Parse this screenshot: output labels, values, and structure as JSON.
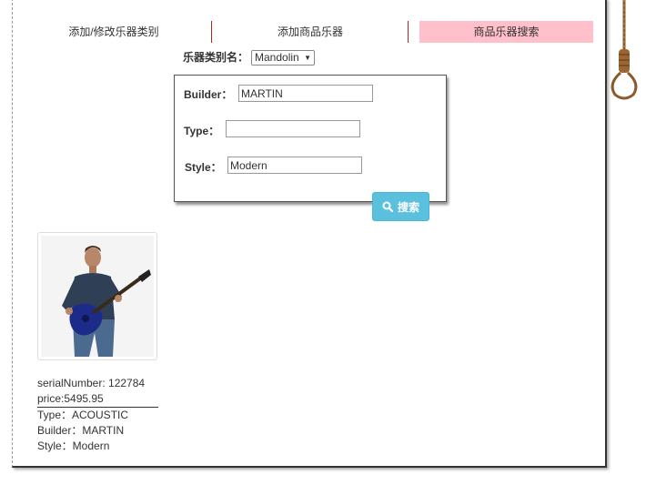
{
  "nav": {
    "tabs": [
      {
        "label": "添加/修改乐器类别"
      },
      {
        "label": "添加商品乐器"
      },
      {
        "label": "商品乐器搜索",
        "active": true
      }
    ],
    "active_color": "#ffbfcb"
  },
  "category": {
    "label": "乐器类别名：",
    "selected": "Mandolin"
  },
  "search_form": {
    "builder_label": "Builder：",
    "builder_value": "MARTIN",
    "type_label": "Type：",
    "type_value": "",
    "style_label": "Style：",
    "style_value": "Modern",
    "search_button": "搜索",
    "button_icon": "search-icon",
    "button_color": "#5bc0de"
  },
  "result": {
    "image_alt": "man playing electric guitar",
    "serial": "serialNumber: 122784",
    "price": "price:5495.95",
    "type": "Type：ACOUSTIC",
    "builder": "Builder：MARTIN",
    "style": "Style：Modern"
  }
}
